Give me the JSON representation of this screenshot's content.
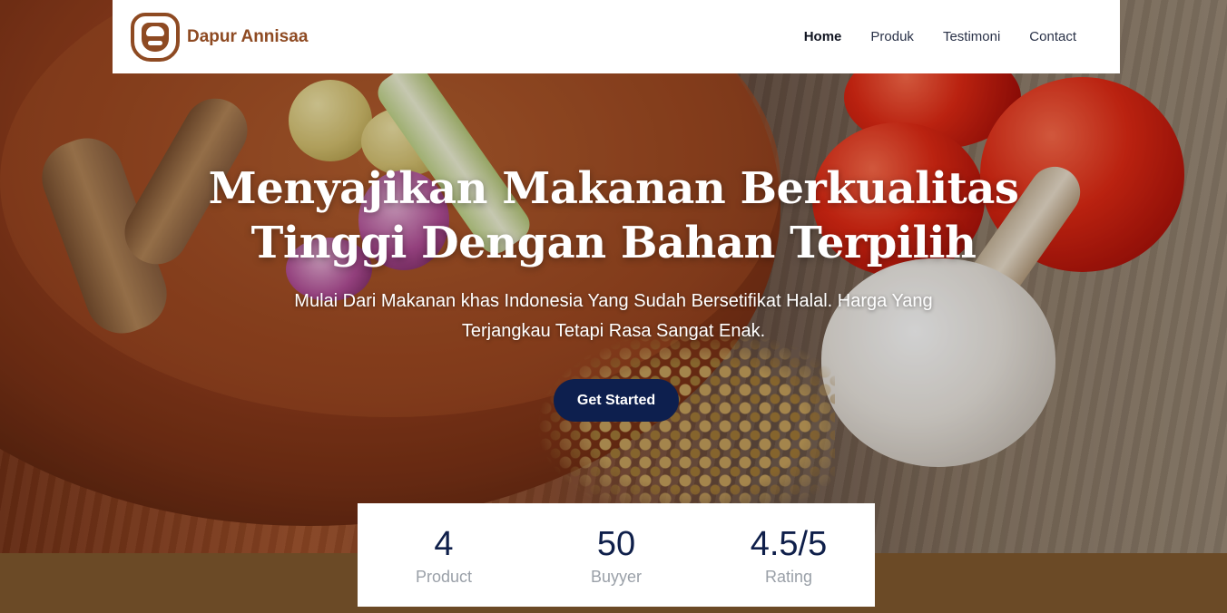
{
  "brand": {
    "name": "Dapur Annisaa",
    "logo_icon": "chef-hat-logo-icon",
    "color": "#8e4a22"
  },
  "nav": {
    "items": [
      {
        "label": "Home",
        "active": true
      },
      {
        "label": "Produk",
        "active": false
      },
      {
        "label": "Testimoni",
        "active": false
      },
      {
        "label": "Contact",
        "active": false
      }
    ]
  },
  "hero": {
    "title": "Menyajikan Makanan Berkualitas Tinggi Dengan Bahan Terpilih",
    "subtitle": "Mulai Dari Makanan khas Indonesia Yang Sudah Bersetifikat Halal. Harga Yang Terjangkau Tetapi Rasa Sangat Enak.",
    "cta_label": "Get Started",
    "cta_color": "#0d1f4e"
  },
  "stats": [
    {
      "value": "4",
      "label": "Product"
    },
    {
      "value": "50",
      "label": "Buyyer"
    },
    {
      "value": "4.5/5",
      "label": "Rating"
    }
  ],
  "colors": {
    "band": "#6b4a26",
    "stat_value": "#0f1f4a",
    "stat_label": "#9aa0a8"
  }
}
